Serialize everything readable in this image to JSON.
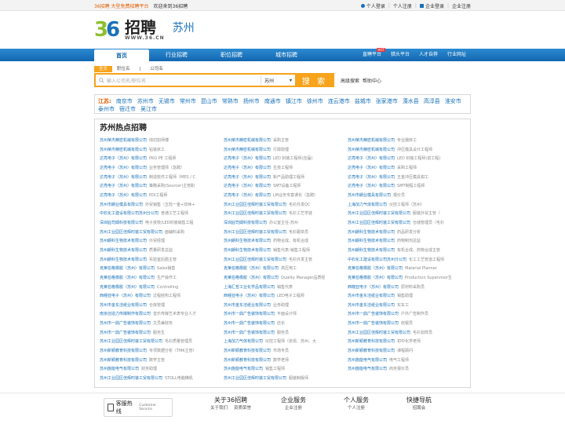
{
  "topbar": {
    "brand_left": "36招聘 大型免费招聘平台",
    "welcome": "欢迎来到36招聘",
    "personal_login": "个人登录",
    "personal_register": "个人注册",
    "company_login": "企业登录",
    "company_register": "企业注册"
  },
  "header": {
    "logo_digits_left": "3",
    "logo_digits_right": "6",
    "logo_text": "招聘",
    "logo_url": "WWW.36.CN",
    "city": "苏州"
  },
  "nav": {
    "items": [
      "首页",
      "行业招聘",
      "职位招聘",
      "城市招聘"
    ],
    "right_items": [
      "直聘平台",
      "猎头平台",
      "人才自荐",
      "行业网址"
    ],
    "hot_badge": "HOT"
  },
  "search": {
    "tabs": [
      "全文",
      "职位名",
      "公司名"
    ],
    "placeholder": "输入公司名/职位名",
    "city": "苏州",
    "button": "搜 索",
    "links": [
      "高级搜索",
      "帮助中心"
    ]
  },
  "cities": {
    "province": "江苏:",
    "list": [
      "南京市",
      "苏州市",
      "无锡市",
      "常州市",
      "昆山市",
      "常熟市",
      "扬州市",
      "南通市",
      "镇江市",
      "徐州市",
      "连云港市",
      "盐城市",
      "张家港市",
      "溧水县",
      "高淳县",
      "淮安市",
      "泰州市",
      "宿迁市",
      "吴江市"
    ]
  },
  "hot": {
    "title": "苏州热点招聘",
    "rows": [
      [
        [
          "苏州荣杰精密机械有限公司",
          "线切割师傅"
        ],
        [
          "苏州荣杰精密机械有限公司",
          "采购主管"
        ],
        [
          "苏州荣杰精密机械有限公司",
          "专业摄床工"
        ]
      ],
      [
        [
          "苏州荣杰精密机械有限公司",
          "钻铣床工"
        ],
        [
          "苏州荣杰精密机械有限公司",
          "行政助理"
        ],
        [
          "苏州荣杰精密机械有限公司",
          "冲压模具设计工程师"
        ]
      ],
      [
        [
          "达亮电子（苏州）有限公司",
          "PKG PE 工程师"
        ],
        [
          "达亮电子（苏州）有限公司",
          "LED 封装工程师(应届)"
        ],
        [
          "达亮电子（苏州）有限公司",
          "LED 封装工程师(前工程)"
        ]
      ],
      [
        [
          "达亮电子（苏州）有限公司",
          "业务管理师（急聘）"
        ],
        [
          "达亮电子（苏州）有限公司",
          "生技工程师"
        ],
        [
          "达亮电子（苏州）有限公司",
          "采购工程师"
        ]
      ],
      [
        [
          "达亮电子（苏州）有限公司",
          "制造软件工程师（MES / C"
        ],
        [
          "达亮电子（苏州）有限公司",
          "新产品助理工程师"
        ],
        [
          "达亮电子（苏州）有限公司",
          "五金冲压模具钳工"
        ]
      ],
      [
        [
          "达亮电子（苏州）有限公司",
          "策略采购(Sourcer)主管职"
        ],
        [
          "达亮电子（苏州）有限公司",
          "SMT设备工程师"
        ],
        [
          "达亮电子（苏州）有限公司",
          "SMT制程工程师"
        ]
      ],
      [
        [
          "达亮电子（苏州）有限公司",
          "EDI工程师"
        ],
        [
          "达亮电子（苏州）有限公司",
          "LM业务专案课长（急聘）"
        ],
        [
          "苏州市朗业模具有限公司",
          "报价员"
        ]
      ],
      [
        [
          "苏州市朗业模具有限公司",
          "外贸销售（五险一金+双休+"
        ],
        [
          "苏州工业园区佳辉时装工贸有限公司",
          "毛衫外发QC"
        ],
        [
          "上海加力气体有限公司",
          "仪控工程师（苏州）"
        ]
      ],
      [
        [
          "中石化工建设有限公司苏州分公司",
          "普通工艺工程师"
        ],
        [
          "苏州工业园区佳辉时装工贸有限公司",
          "毛衫工艺学徒"
        ],
        [
          "苏州工业园区佳辉时装工贸有限公司",
          "服装外贸主管（"
        ]
      ],
      [
        [
          "深圳庇司姆科技有限公司",
          "电子技校/LED封装销售工程"
        ],
        [
          "深圳庇司姆科技有限公司",
          "办公室主任-苏州"
        ],
        [
          "苏州工业园区佳辉时装工贸有限公司",
          "仓储管理员（毛衫"
        ]
      ],
      [
        [
          "苏州工业园区佳辉时装工贸有限公司",
          "面辅料采购"
        ],
        [
          "苏州工业园区佳辉时装工贸有限公司",
          "毛衫跟单员"
        ],
        [
          "苏州朗科生物技术有限公司",
          "药品研发分析"
        ]
      ],
      [
        [
          "苏州朗科生物技术有限公司",
          "外贸经理"
        ],
        [
          "苏州朗科生物技术有限公司",
          "药物合成、有机合成"
        ],
        [
          "苏州朗科生物技术有限公司",
          "药物制剂总监"
        ]
      ],
      [
        [
          "苏州朗科生物技术有限公司",
          "质量研发总监"
        ],
        [
          "苏州朗科生物技术有限公司",
          "销售代表-销售工程师"
        ],
        [
          "苏州朗科生物技术有限公司",
          "有机合成、药物合成主管"
        ]
      ],
      [
        [
          "苏州朗科生物技术有限公司",
          "实验室后勤主管"
        ],
        [
          "苏州工业园区佳辉时装工贸有限公司",
          "毛衫外发主管"
        ],
        [
          "中石化工建设有限公司苏州分公司",
          "化工工艺管道工程师"
        ]
      ],
      [
        [
          "克莱伯格橡胶（苏州）有限公司",
          "Sales销售"
        ],
        [
          "克莱伯格橡胶（苏州）有限公司",
          "高压电工"
        ],
        [
          "克莱伯格橡胶（苏州）有限公司",
          "Material Planner"
        ]
      ],
      [
        [
          "克莱伯格橡胶（苏州）有限公司",
          "生产操作工"
        ],
        [
          "克莱伯格橡胶（苏州）有限公司",
          "Quality Manager品质经"
        ],
        [
          "克莱伯格橡胶（苏州）有限公司",
          "Production Supervisor生"
        ]
      ],
      [
        [
          "克莱伯格橡胶（苏州）有限公司",
          "Controlling"
        ],
        [
          "上海汇哲工业化学品有限公司",
          "销售代表"
        ],
        [
          "西幢亚电子（苏州）有限公司",
          "原材料采购员"
        ]
      ],
      [
        [
          "西幢亚电子（苏州）有限公司",
          "过程结构工程师"
        ],
        [
          "西幢亚电子（苏州）有限公司",
          "LED电子工程师"
        ],
        [
          "苏州市金东洁纸业有限公司",
          "销售助理"
        ]
      ],
      [
        [
          "苏州市金东洁纸业有限公司",
          "仓库管理"
        ],
        [
          "苏州市金东洁纸业有限公司",
          "业务助理"
        ],
        [
          "苏州市金东洁纸业有限公司",
          "实车工"
        ]
      ],
      [
        [
          "南京创造力传媒制作有限公司",
          "音乐传媒艺术表专业人才"
        ],
        [
          "苏州市一鼎广告装饰有限公司",
          "平面设计师"
        ],
        [
          "苏州市一鼎广告装饰有限公司",
          "户外广告制作员"
        ]
      ],
      [
        [
          "苏州市一鼎广告装饰有限公司",
          "文员兼财务"
        ],
        [
          "苏州市一鼎广告装饰有限公司",
          "店长"
        ],
        [
          "苏州市一鼎广告装饰有限公司",
          "收银员"
        ]
      ],
      [
        [
          "苏州市一鼎广告装饰有限公司",
          "服务生"
        ],
        [
          "苏州市一鼎广告装饰有限公司",
          "服务员"
        ],
        [
          "苏州工业园区佳辉时装工贸有限公司",
          "毛衫割样员"
        ]
      ],
      [
        [
          "苏州工业园区佳辉时装工贸有限公司",
          "毛衫质量管理员"
        ],
        [
          "上海加力气体有限公司",
          "仪控工程师（张昆、苏州、大"
        ],
        [
          "苏州新颖教育科技有限公司",
          "初中化学老师"
        ]
      ],
      [
        [
          "苏州新颖教育科技有限公司",
          "专项数据分析（TMK主管）"
        ],
        [
          "苏州新颖教育科技有限公司",
          "市场专员"
        ],
        [
          "苏州新颖教育科技有限公司",
          "课程顾问"
        ]
      ],
      [
        [
          "苏州新颖教育科技有限公司",
          "数学主管"
        ],
        [
          "苏州新颖教育科技有限公司",
          "数学老师"
        ],
        [
          "苏州施能电气有限公司",
          "电气工程师"
        ]
      ],
      [
        [
          "苏州施能电气有限公司",
          "财务助理"
        ],
        [
          "苏州施能电气有限公司",
          "销售工程师"
        ],
        [
          "苏州施能电气有限公司",
          "商务报价员"
        ]
      ],
      [
        [
          "苏州工业园区佳辉时装工贸有限公司",
          "STOLL电脑横机"
        ],
        [
          "苏州工业园区佳辉时装工贸有限公司",
          "服装制版师"
        ],
        [
          "",
          ""
        ]
      ]
    ]
  },
  "footer": {
    "hotline_title": "客服热线",
    "hotline_sub": "Customer Service",
    "cols": [
      {
        "title": "关于36招聘",
        "links": [
          "关于我们",
          "资质荣誉"
        ]
      },
      {
        "title": "企业服务",
        "links": [
          "企业注册"
        ]
      },
      {
        "title": "个人服务",
        "links": [
          "个人注册"
        ]
      },
      {
        "title": "快捷导航",
        "links": [
          "招聘会"
        ]
      }
    ]
  }
}
